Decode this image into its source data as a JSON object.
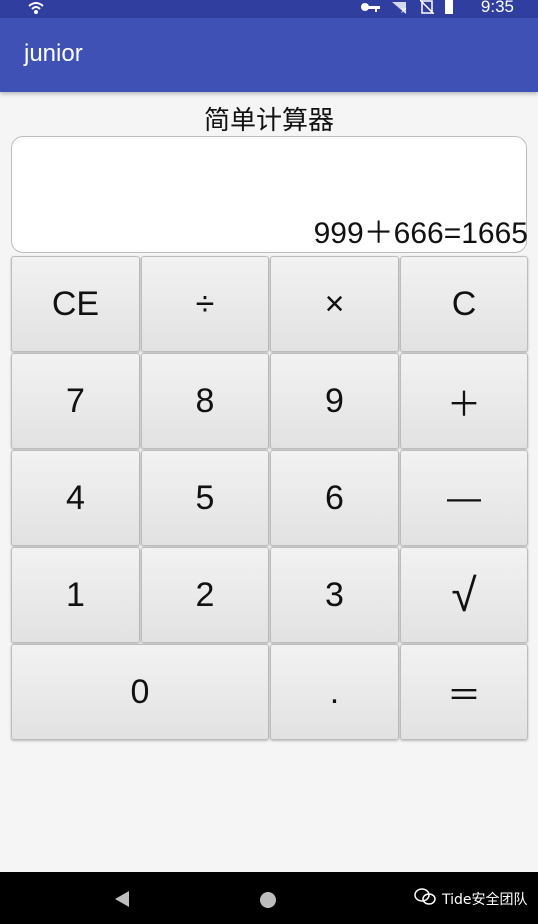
{
  "status_bar": {
    "time": "9:35",
    "icons": [
      "wifi-icon",
      "key-icon",
      "signal-off-icon",
      "no-sim-icon",
      "battery-icon"
    ]
  },
  "app_bar": {
    "title": "junior"
  },
  "calculator": {
    "title": "简单计算器",
    "display": "999＋666=1665",
    "keys": {
      "ce": "CE",
      "divide": "÷",
      "multiply": "×",
      "clear": "C",
      "seven": "7",
      "eight": "8",
      "nine": "9",
      "plus": "＋",
      "four": "4",
      "five": "5",
      "six": "6",
      "minus": "—",
      "one": "1",
      "two": "2",
      "three": "3",
      "sqrt": "√",
      "zero": "0",
      "dot": ".",
      "equals": "＝"
    }
  },
  "nav_bar": {
    "watermark": "Tide安全团队"
  }
}
